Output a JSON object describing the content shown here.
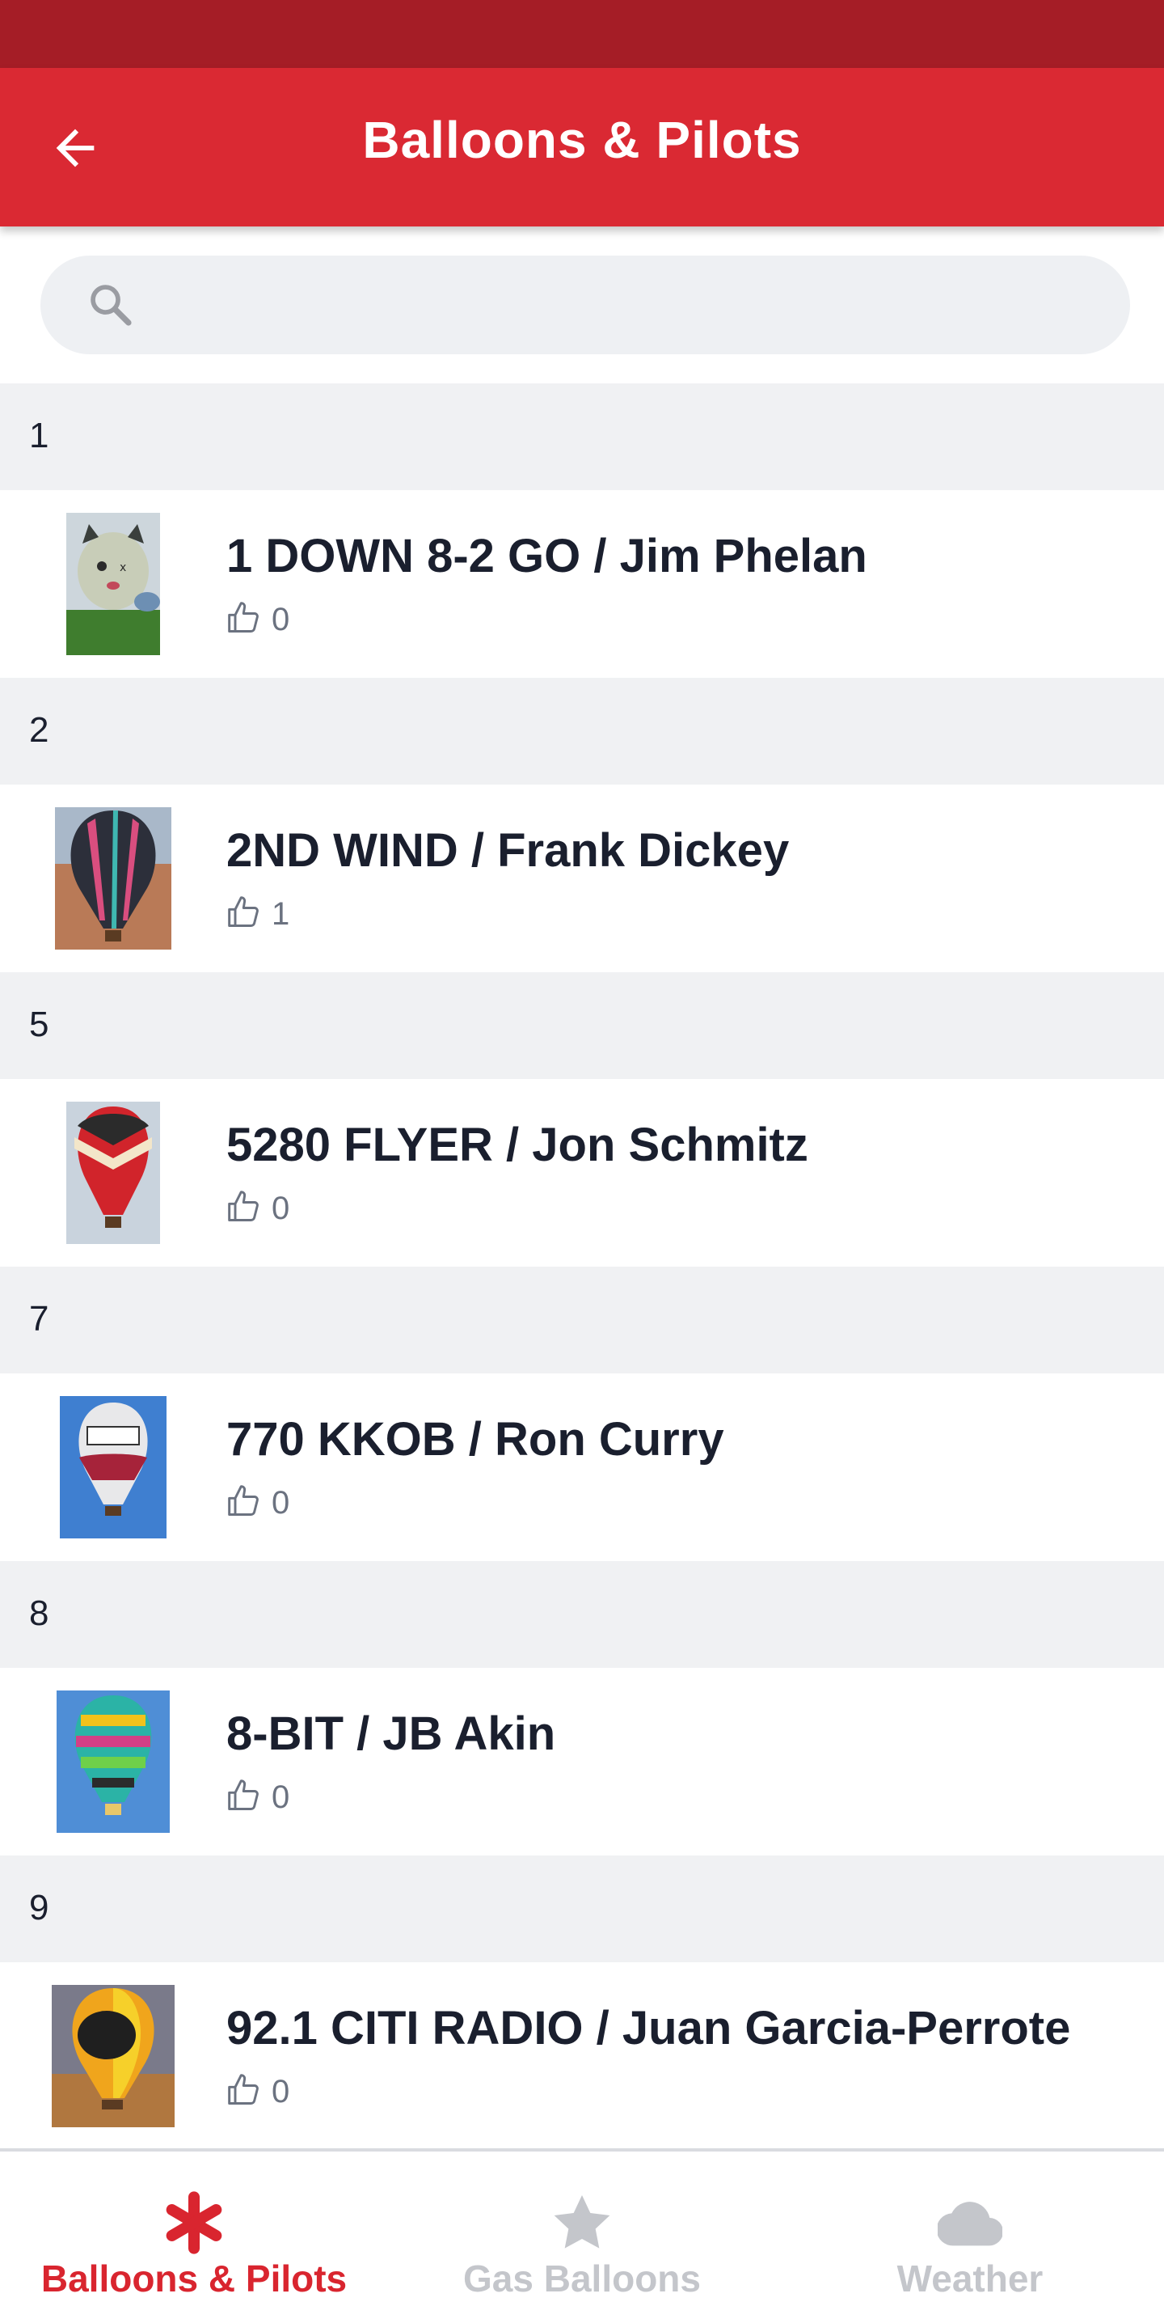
{
  "header": {
    "title": "Balloons & Pilots"
  },
  "search": {
    "placeholder": "",
    "value": ""
  },
  "sections": [
    {
      "letter": "1",
      "title": "1 DOWN 8-2 GO / Jim Phelan",
      "likes": "0",
      "thumb": "cat-face-balloon"
    },
    {
      "letter": "2",
      "title": "2ND WIND / Frank Dickey",
      "likes": "1",
      "thumb": "striped-balloon"
    },
    {
      "letter": "5",
      "title": "5280 FLYER / Jon Schmitz",
      "likes": "0",
      "thumb": "red-chevron-balloon"
    },
    {
      "letter": "7",
      "title": "770 KKOB / Ron Curry",
      "likes": "0",
      "thumb": "kkob-balloon"
    },
    {
      "letter": "8",
      "title": "8-BIT / JB Akin",
      "likes": "0",
      "thumb": "pixel-balloon"
    },
    {
      "letter": "9",
      "title": "92.1 CITI RADIO / Juan Garcia-Perrote",
      "likes": "0",
      "thumb": "citi-radio-balloon"
    }
  ],
  "tabs": [
    {
      "label": "Balloons & Pilots",
      "icon": "asterisk-icon",
      "active": true
    },
    {
      "label": "Gas Balloons",
      "icon": "star-icon",
      "active": false
    },
    {
      "label": "Weather",
      "icon": "cloud-icon",
      "active": false
    }
  ],
  "colors": {
    "status_bar": "#a51d26",
    "header": "#da2933",
    "active_tab": "#d9252f",
    "inactive_tab": "#c4c6cb",
    "section_bg": "#f0f1f3"
  }
}
